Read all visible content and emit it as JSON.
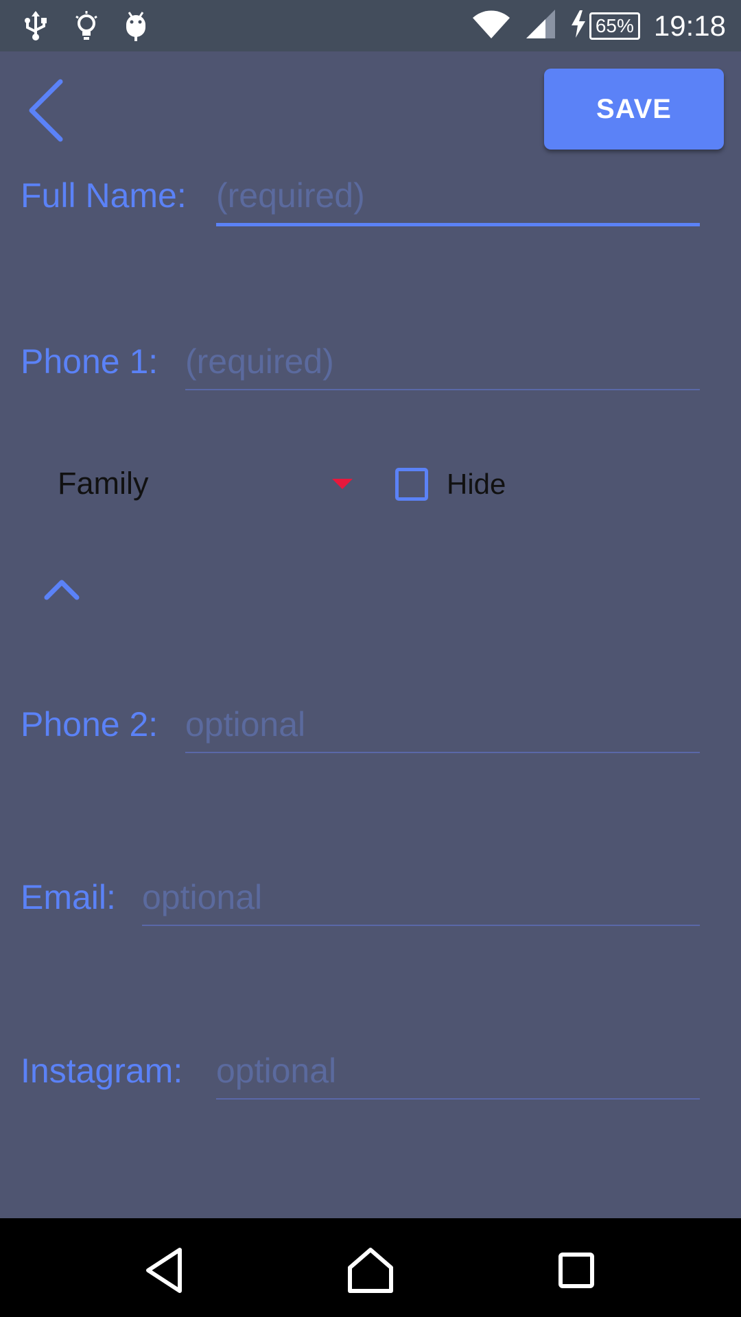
{
  "status_bar": {
    "left_icons": [
      "usb-icon",
      "bulb-icon",
      "android-debug-icon"
    ],
    "right_icons": [
      "wifi-icon",
      "signal-icon",
      "charging-icon"
    ],
    "battery_percent": "65%",
    "time": "19:18"
  },
  "header": {
    "back_icon": "chevron-left-icon",
    "save_label": "SAVE"
  },
  "form": {
    "full_name": {
      "label": "Full Name:",
      "placeholder": "(required)"
    },
    "phone1": {
      "label": "Phone 1:",
      "placeholder": "(required)"
    },
    "phone_type": {
      "selected": "Family"
    },
    "hide": {
      "label": "Hide",
      "checked": false
    },
    "collapse_icon": "chevron-up-icon",
    "phone2": {
      "label": "Phone 2:",
      "placeholder": "optional"
    },
    "email": {
      "label": "Email:",
      "placeholder": "optional"
    },
    "instagram": {
      "label": "Instagram:",
      "placeholder": "optional"
    }
  },
  "nav_bar": {
    "buttons": [
      "back-triangle-icon",
      "home-icon",
      "recents-icon"
    ]
  },
  "colors": {
    "accent": "#5b82f7",
    "background": "#4f5571",
    "status_bar": "#434d5c",
    "dropdown_arrow": "#e8183c"
  }
}
